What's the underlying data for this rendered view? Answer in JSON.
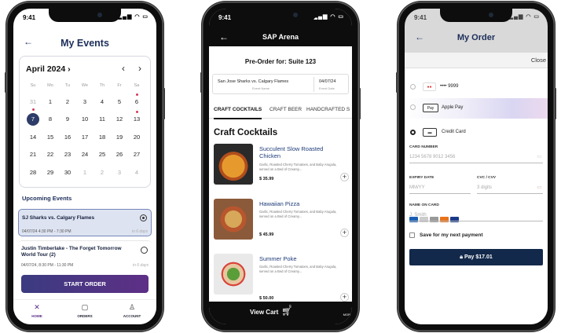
{
  "phone1": {
    "time": "9:41",
    "title": "My Events",
    "month": "April 2024",
    "weekdays": [
      "Su",
      "Mo",
      "Tu",
      "We",
      "Th",
      "Fr",
      "Sa"
    ],
    "days": [
      "31",
      "1",
      "2",
      "3",
      "4",
      "5",
      "6",
      "7",
      "8",
      "9",
      "10",
      "11",
      "12",
      "13",
      "14",
      "15",
      "16",
      "17",
      "18",
      "19",
      "20",
      "21",
      "22",
      "23",
      "24",
      "25",
      "26",
      "27",
      "28",
      "29",
      "30",
      "1",
      "2",
      "3",
      "4"
    ],
    "upcoming_label": "Upcoming Events",
    "events": [
      {
        "name": "SJ Sharks vs. Calgary Flames",
        "date": "04/07/24 4:30 PM - 7:30 PM",
        "in": "in 6 days",
        "selected": true
      },
      {
        "name": "Justin Timberlake - The Forget Tomorrow World Tour (2)",
        "date": "04/07/24, 8:30 PM - 11:30 PM",
        "in": "in 6 days",
        "selected": false
      }
    ],
    "start_order": "START ORDER",
    "tabs": [
      {
        "label": "HOME",
        "icon": "home-icon"
      },
      {
        "label": "ORDERS",
        "icon": "orders-icon"
      },
      {
        "label": "ACCOUNT",
        "icon": "account-icon"
      }
    ],
    "accent": "#2d3c68"
  },
  "phone2": {
    "time": "9:41",
    "title": "SAP Arena",
    "preorder": "Pre-Order for:  Suite 123",
    "event_name": "San Jose Sharks vs. Calgary Flames",
    "event_label": "Event Name",
    "event_date": "04/07/24",
    "date_label": "Event Date",
    "categories": [
      "CRAFT COCKTAILS",
      "CRAFT BEER",
      "HANDCRAFTED S"
    ],
    "section": "Craft Cocktails",
    "items": [
      {
        "name": "Succulent Slow Roasted Chicken",
        "desc": "Garlic, Roasted Cherry Tomatoes, and Baby Arugula, served on a Bed of Creamy...",
        "price": "$ 35.99"
      },
      {
        "name": "Hawaiian Pizza",
        "desc": "Garlic, Roasted Cherry Tomatoes, and Baby Arugula, served on a Bed of Creamy...",
        "price": "$ 45.99"
      },
      {
        "name": "Summer Poke",
        "desc": "Garlic, Roasted Cherry Tomatoes, and Baby Arugula, served on a Bed of Creamy...",
        "price": "$ 50.00"
      }
    ],
    "view_cart": "View Cart",
    "cart_count": "0",
    "more": "MOR"
  },
  "phone3": {
    "time": "9:41",
    "title": "My Order",
    "close": "Close",
    "saved_card": "•••• 9999",
    "apple_pay": "Apple Pay",
    "apple_pay_logo": "Pay",
    "credit_card": "Credit Card",
    "card_number_label": "CARD NUMBER",
    "card_number_placeholder": "1234 5678 9012 3456",
    "expiry_label": "EXPIRY DATE",
    "expiry_placeholder": "MM/YY",
    "cvc_label": "CVC / CVV",
    "cvc_placeholder": "3 digits",
    "name_label": "NAME ON CARD",
    "name_placeholder": "J. Smith",
    "save_label": "Save for my next payment",
    "pay_button": "Pay $17.01"
  }
}
